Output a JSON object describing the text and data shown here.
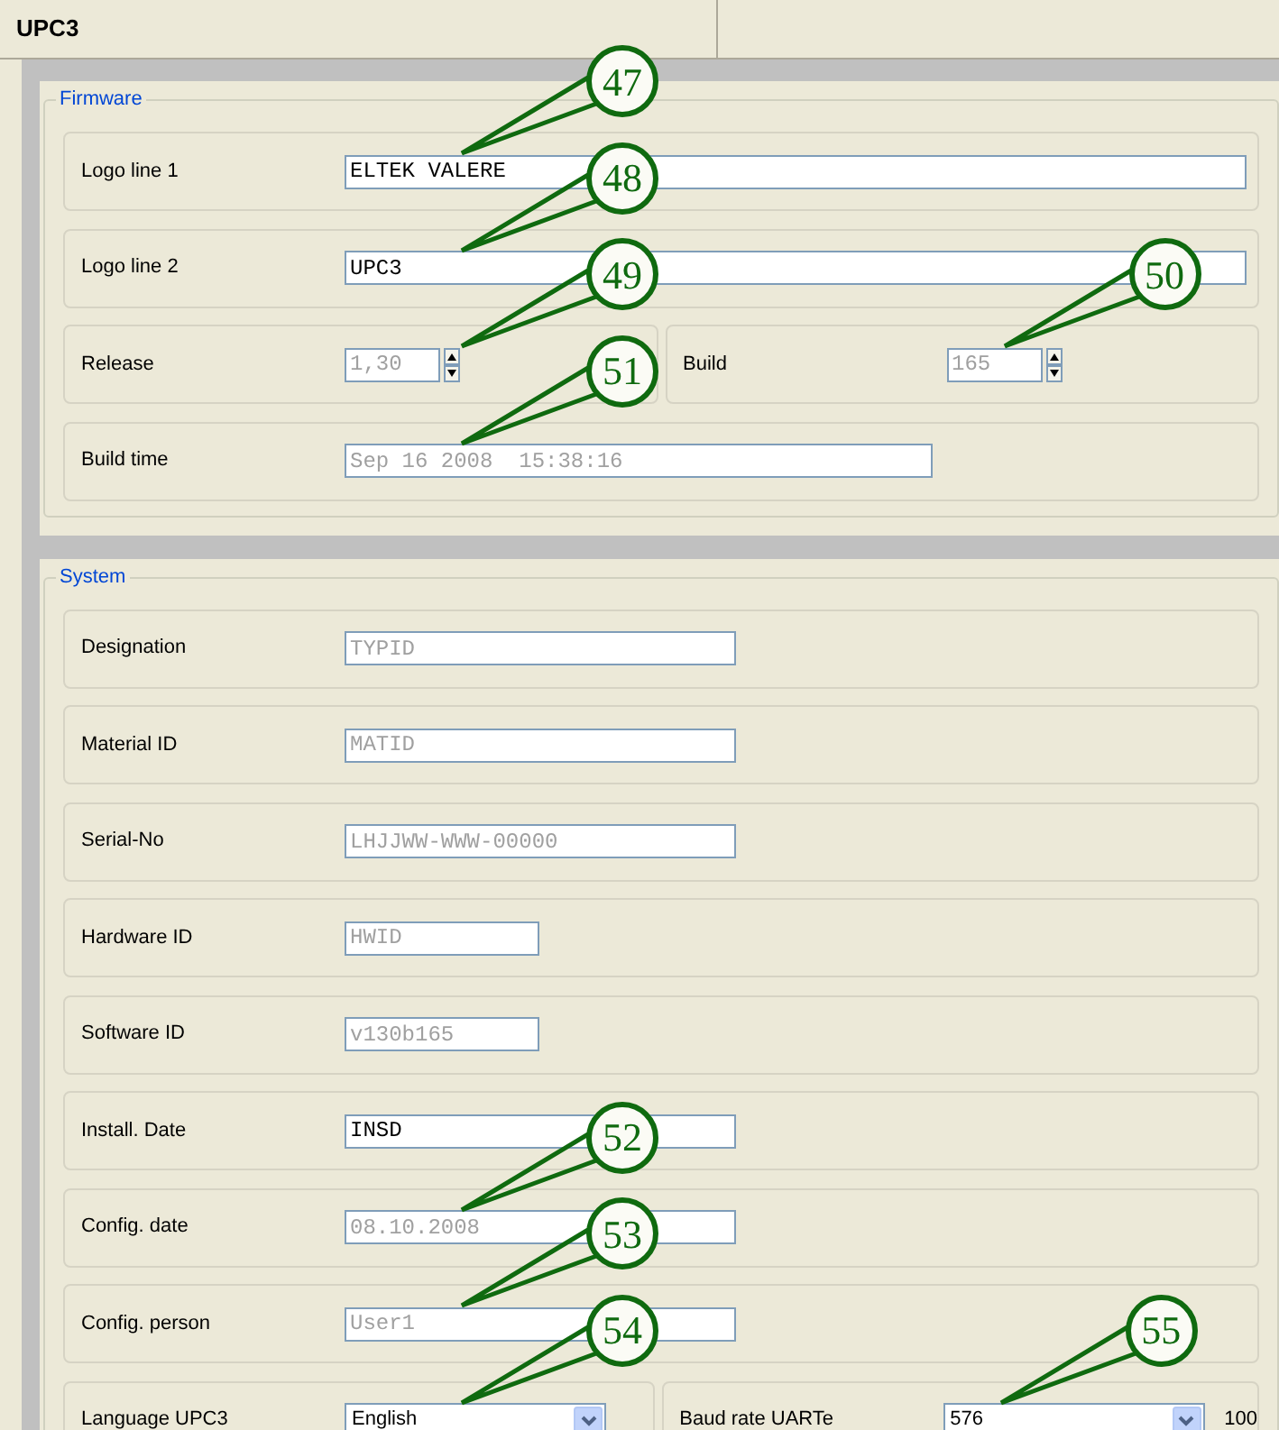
{
  "window": {
    "title": "UPC3"
  },
  "groups": [
    {
      "legend": "Firmware",
      "rows": [
        [
          {
            "label": "Logo line 1",
            "kind": "text_wide",
            "value": "ELTEK VALERE",
            "disabled": false,
            "callout": "47"
          }
        ],
        [
          {
            "label": "Logo line 2",
            "kind": "text_wide",
            "value": "UPC3",
            "disabled": false,
            "callout": "48"
          }
        ],
        [
          {
            "label": "Release",
            "kind": "spin",
            "value": "1,30",
            "disabled": true,
            "callout": "49"
          },
          {
            "label": "Build",
            "kind": "spin",
            "value": "165",
            "disabled": true,
            "callout": "50"
          }
        ],
        [
          {
            "label": "Build time",
            "kind": "text_long",
            "value": "Sep 16 2008  15:38:16",
            "disabled": true,
            "callout": "51"
          }
        ]
      ]
    },
    {
      "legend": "System",
      "rows": [
        [
          {
            "label": "Designation",
            "kind": "text",
            "value": "TYPID",
            "disabled": true
          }
        ],
        [
          {
            "label": "Material ID",
            "kind": "text",
            "value": "MATID",
            "disabled": true
          }
        ],
        [
          {
            "label": "Serial-No",
            "kind": "text",
            "value": "LHJJWW-WWW-00000",
            "disabled": true
          }
        ],
        [
          {
            "label": "Hardware ID",
            "kind": "text_short",
            "value": "HWID",
            "disabled": true
          }
        ],
        [
          {
            "label": "Software ID",
            "kind": "text_short",
            "value": "v130b165",
            "disabled": true
          }
        ],
        [
          {
            "label": "Install. Date",
            "kind": "text",
            "value": "INSD",
            "disabled": false
          }
        ],
        [
          {
            "label": "Config. date",
            "kind": "text",
            "value": "08.10.2008",
            "disabled": true,
            "callout": "52"
          }
        ],
        [
          {
            "label": "Config. person",
            "kind": "text",
            "value": "User1",
            "disabled": true,
            "callout": "53"
          }
        ],
        [
          {
            "label": "Language UPC3",
            "kind": "dropdown",
            "value": "English",
            "disabled": false,
            "callout": "54"
          },
          {
            "label": "Baud rate UARTe",
            "kind": "dropdown",
            "value": "576",
            "disabled": false,
            "callout": "55",
            "suffix": "100"
          }
        ]
      ]
    }
  ]
}
